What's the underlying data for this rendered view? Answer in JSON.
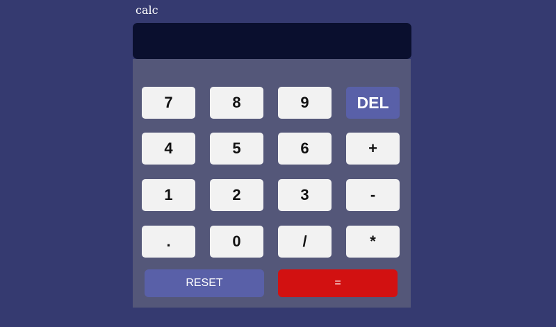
{
  "app": {
    "title": "calc"
  },
  "display": {
    "value": ""
  },
  "keys": {
    "row1": [
      "7",
      "8",
      "9",
      "DEL"
    ],
    "row2": [
      "4",
      "5",
      "6",
      "+"
    ],
    "row3": [
      "1",
      "2",
      "3",
      "-"
    ],
    "row4": [
      ".",
      "0",
      "/",
      "*"
    ]
  },
  "actions": {
    "reset_label": "RESET",
    "equals_label": "="
  },
  "colors": {
    "background": "#353a70",
    "display": "#0a0f2e",
    "keypad": "#545779",
    "key": "#f2f2f2",
    "accent": "#5960a8",
    "equals": "#d21111"
  }
}
